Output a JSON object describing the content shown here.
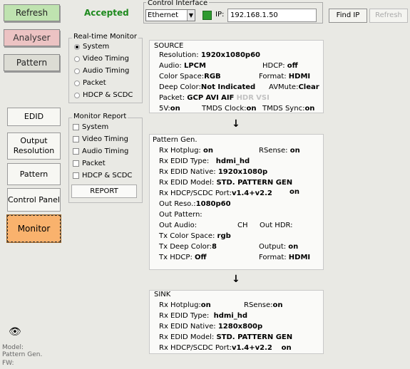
{
  "top": {
    "refresh": "Refresh",
    "analyser": "Analyser",
    "pattern": "Pattern",
    "status": "Accepted"
  },
  "control_interface": {
    "legend": "Control Interface",
    "interface": "Ethernet",
    "ip_label": "IP:",
    "ip": "192.168.1.50",
    "find_ip": "Find IP",
    "refresh": "Refresh"
  },
  "realtime_monitor": {
    "legend": "Real-time Monitor",
    "options": [
      "System",
      "Video Timing",
      "Audio Timing",
      "Packet",
      "HDCP & SCDC"
    ],
    "selected": "System"
  },
  "monitor_report": {
    "legend": "Monitor Report",
    "options": [
      "System",
      "Video Timing",
      "Audio Timing",
      "Packet",
      "HDCP & SCDC"
    ],
    "button": "REPORT"
  },
  "nav": {
    "edid": "EDID",
    "output_resolution": "Output Resolution",
    "pattern": "Pattern",
    "control_panel": "Control Panel",
    "monitor": "Monitor"
  },
  "source": {
    "title": "SOURCE",
    "resolution_label": "Resolution:",
    "resolution": "1920x1080p60",
    "audio_label": "Audio:",
    "audio": "LPCM",
    "hdcp_label": "HDCP:",
    "hdcp": "off",
    "colorspace_label": "Color Space:",
    "colorspace": "RGB",
    "format_label": "Format:",
    "format": "HDMI",
    "deepcolor_label": "Deep Color:",
    "deepcolor": "Not Indicated",
    "avmute_label": "AVMute:",
    "avmute": "Clear",
    "packet_label": "Packet:",
    "packets_active": [
      "GCP",
      "AVI",
      "AIF"
    ],
    "packets_inactive": [
      "HDR",
      "VSI"
    ],
    "fivev_label": "5V:",
    "fivev": "on",
    "tmds_clock_label": "TMDS Clock:",
    "tmds_clock": "on",
    "tmds_sync_label": "TMDS Sync:",
    "tmds_sync": "on"
  },
  "pattern_gen": {
    "title": "Pattern Gen.",
    "rx_hotplug_label": "Rx Hotplug:",
    "rx_hotplug": "on",
    "rsense_label": "RSense:",
    "rsense": "on",
    "rx_edid_type_label": "Rx EDID Type:",
    "rx_edid_type": "hdmi_hd",
    "rx_edid_native_label": "Rx EDID Native:",
    "rx_edid_native": "1920x1080p",
    "rx_edid_model_label": "Rx EDID Model:",
    "rx_edid_model": "STD.  PATTERN GEN",
    "rx_hdcp_label": "Rx HDCP/SCDC Port:",
    "rx_hdcp": "v1.4+v2.2",
    "rx_hdcp_state": "on",
    "out_reso_label": "Out Reso.:",
    "out_reso": "1080p60",
    "out_pattern_label": "Out Pattern:",
    "out_audio_label": "Out Audio:",
    "out_audio_ch": "CH",
    "out_hdr_label": "Out HDR:",
    "tx_colorspace_label": "Tx Color Space:",
    "tx_colorspace": "rgb",
    "tx_deepcolor_label": "Tx Deep Color:",
    "tx_deepcolor": "8",
    "output_label": "Output:",
    "output": "on",
    "tx_hdcp_label": "Tx HDCP:",
    "tx_hdcp": "Off",
    "format_label": "Format:",
    "format": "HDMI"
  },
  "sink": {
    "title": "SINK",
    "rx_hotplug_label": "Rx Hotplug:",
    "rx_hotplug": "on",
    "rsense_label": "RSense:",
    "rsense": "on",
    "rx_edid_type_label": "Rx EDID Type:",
    "rx_edid_type": "hdmi_hd",
    "rx_edid_native_label": "Rx EDID Native:",
    "rx_edid_native": "1280x800p",
    "rx_edid_model_label": "Rx EDID Model:",
    "rx_edid_model": "STD.  PATTERN GEN",
    "rx_hdcp_label": "Rx HDCP/SCDC Port:",
    "rx_hdcp": "v1.4+v2.2",
    "rx_hdcp_state": "on"
  },
  "arrows": {
    "down": "↓"
  },
  "footer": {
    "eye_icon": "👁",
    "model_label": "Model:",
    "model": "Pattern Gen.",
    "fw_label": "FW:"
  }
}
